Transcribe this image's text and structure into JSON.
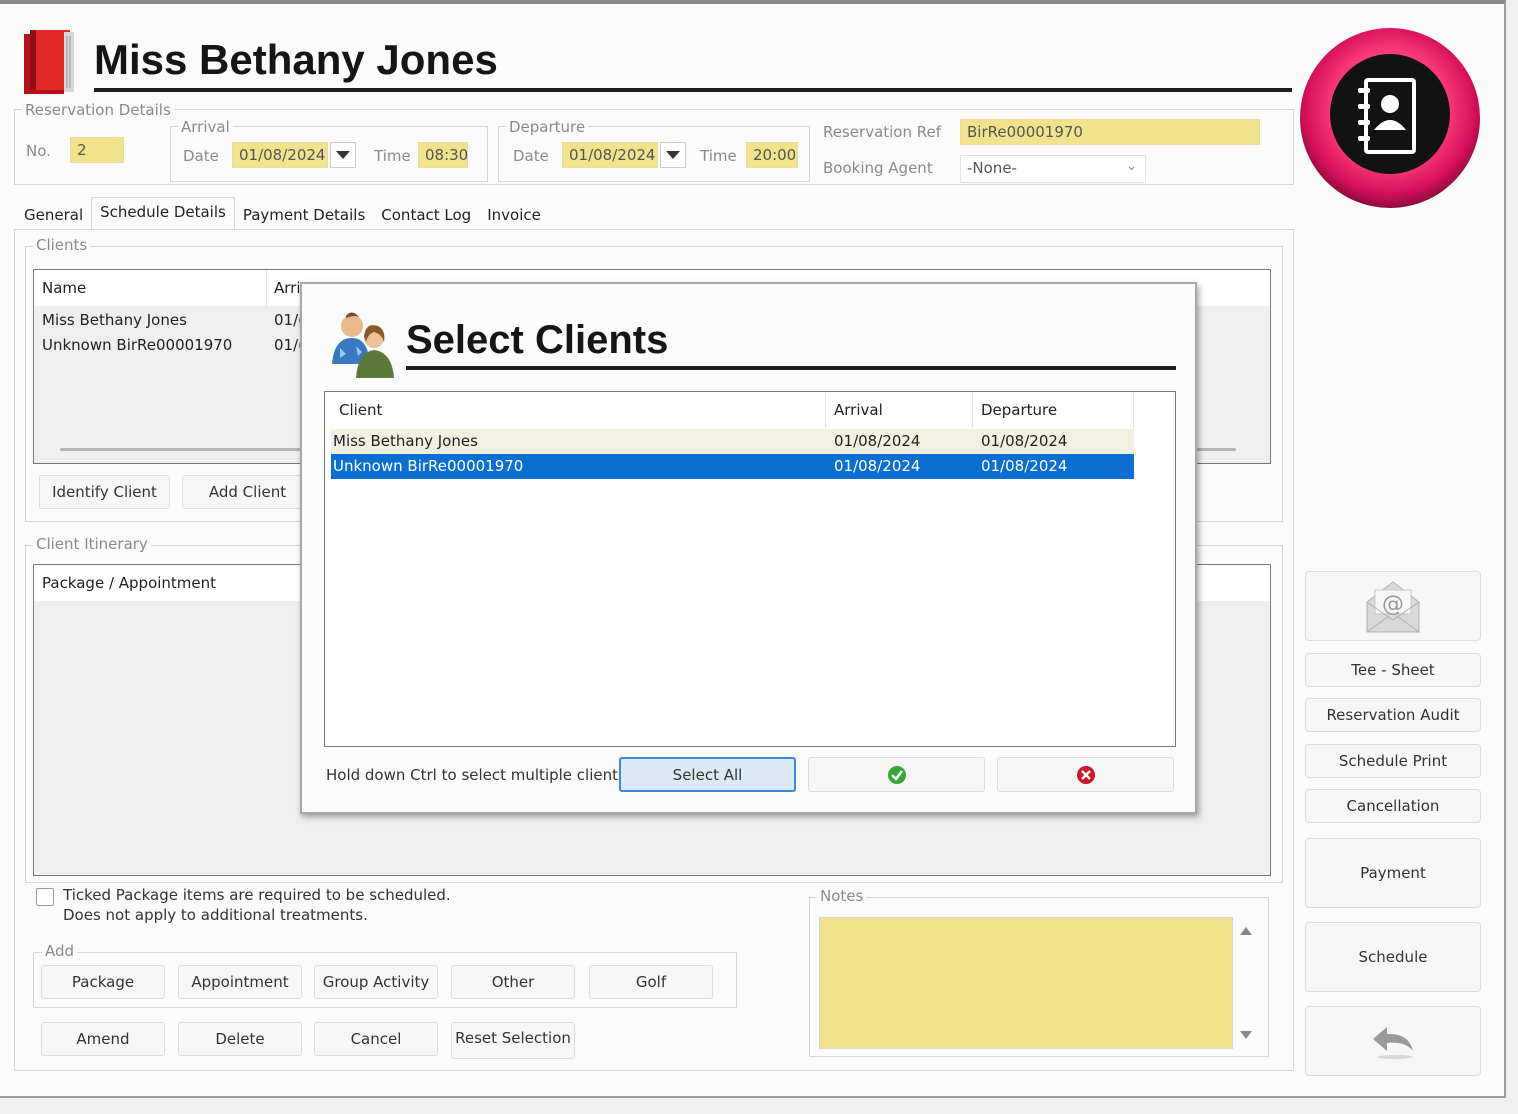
{
  "window": {
    "title": "Miss Bethany Jones"
  },
  "reservation": {
    "group_label": "Reservation Details",
    "no_label": "No.",
    "no_value": "2",
    "arrival": {
      "group_label": "Arrival",
      "date_label": "Date",
      "date_value": "01/08/2024",
      "time_label": "Time",
      "time_value": "08:30"
    },
    "departure": {
      "group_label": "Departure",
      "date_label": "Date",
      "date_value": "01/08/2024",
      "time_label": "Time",
      "time_value": "20:00"
    },
    "ref_label": "Reservation Ref",
    "ref_value": "BirRe00001970",
    "agent_label": "Booking Agent",
    "agent_value": "-None-"
  },
  "tabs": [
    {
      "label": "General"
    },
    {
      "label": "Schedule Details",
      "active": true
    },
    {
      "label": "Payment Details"
    },
    {
      "label": "Contact Log"
    },
    {
      "label": "Invoice"
    }
  ],
  "clients": {
    "group_label": "Clients",
    "columns": [
      "Name",
      "Arri"
    ],
    "rows": [
      {
        "name": "Miss Bethany Jones",
        "arrival": "01/("
      },
      {
        "name": "Unknown BirRe00001970",
        "arrival": "01/("
      }
    ],
    "identify_button": "Identify Client",
    "add_button": "Add Client"
  },
  "itinerary": {
    "group_label": "Client Itinerary",
    "column": "Package / Appointment"
  },
  "package_note": {
    "line1": "Ticked Package items are required to be scheduled.",
    "line2": "Does not apply to additional treatments."
  },
  "add": {
    "group_label": "Add",
    "buttons": [
      "Package",
      "Appointment",
      "Group Activity",
      "Other",
      "Golf"
    ]
  },
  "actions": {
    "amend": "Amend",
    "delete": "Delete",
    "cancel": "Cancel",
    "reset": "Reset Selection"
  },
  "notes": {
    "group_label": "Notes",
    "value": ""
  },
  "side_buttons": {
    "tee_sheet": "Tee - Sheet",
    "audit": "Reservation Audit",
    "schedule_print": "Schedule Print",
    "cancellation": "Cancellation",
    "payment": "Payment",
    "schedule": "Schedule"
  },
  "dialog": {
    "title": "Select Clients",
    "columns": [
      "Client",
      "Arrival",
      "Departure"
    ],
    "rows": [
      {
        "client": "Miss Bethany Jones",
        "arrival": "01/08/2024",
        "departure": "01/08/2024",
        "selected": false
      },
      {
        "client": "Unknown BirRe00001970",
        "arrival": "01/08/2024",
        "departure": "01/08/2024",
        "selected": true
      }
    ],
    "hint": "Hold down Ctrl to select multiple clients",
    "select_all": "Select All"
  },
  "colors": {
    "field_yellow": "#f0e38c",
    "selection_blue": "#0a6fd0",
    "brand_magenta": "#e0145a"
  }
}
